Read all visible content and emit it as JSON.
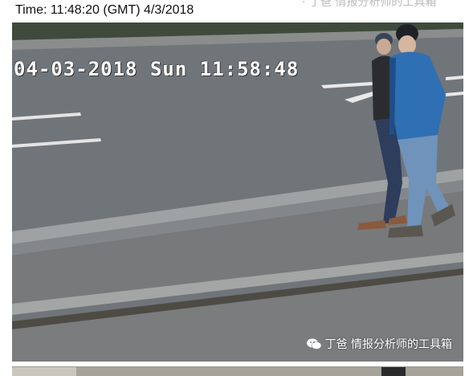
{
  "caption": "Time: 11:48:20 (GMT)  4/3/2018",
  "top_watermark": "· 丁爸 情报分析师的工具箱",
  "cctv": {
    "osd_timestamp": "04-03-2018 Sun 11:58:48",
    "watermark_text": "丁爸 情报分析师的工具箱",
    "watermark_icon": "wechat-icon"
  },
  "colors": {
    "road": "#6f7479",
    "kerb": "#a9abaa",
    "jacket_blue": "#2f6fb3",
    "jacket_dark": "#2a2c30"
  }
}
